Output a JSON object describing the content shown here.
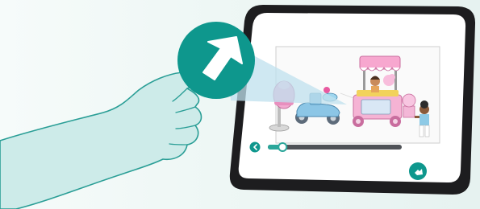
{
  "theme": {
    "accent": "#0e978d",
    "accent_light": "#2aa69a",
    "hand_fill": "#cdebe9",
    "hand_stroke": "#2a9e96",
    "device_frame": "#1d1d1f",
    "cover": "#c9ccce"
  },
  "icons": {
    "zoom_callout": "next-arrow-icon",
    "prev": "chevron-left-icon",
    "next": "chevron-right-icon"
  },
  "player": {
    "progress": 0.11
  }
}
